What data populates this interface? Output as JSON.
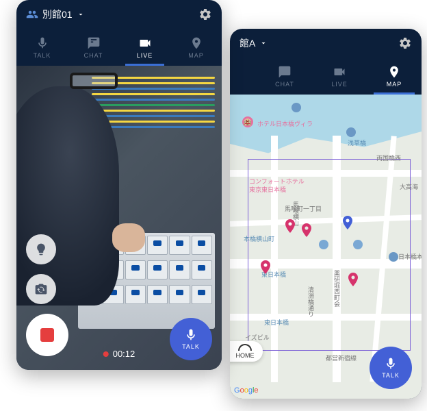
{
  "leftPhone": {
    "header": {
      "title": "別館01"
    },
    "tabs": [
      {
        "id": "talk",
        "label": "TALK"
      },
      {
        "id": "chat",
        "label": "CHAT"
      },
      {
        "id": "live",
        "label": "LIVE",
        "active": true
      },
      {
        "id": "map",
        "label": "MAP"
      }
    ],
    "recording": {
      "time": "00:12"
    },
    "talkButton": {
      "label": "TALK"
    }
  },
  "rightPhone": {
    "header": {
      "title": "館A"
    },
    "tabs": [
      {
        "id": "chat",
        "label": "CHAT"
      },
      {
        "id": "live",
        "label": "LIVE"
      },
      {
        "id": "map",
        "label": "MAP",
        "active": true
      }
    ],
    "talkButton": {
      "label": "TALK"
    },
    "homeButton": {
      "label": "HOME"
    },
    "mapAttribution": "Google",
    "mapLabels": {
      "hotel1": "ホテル日本橋ヴィラ",
      "comfort1": "コンフォートホテル",
      "comfort2": "東京東日本橋",
      "asakusa": "浅草橋",
      "ryogoku": "両国橋西",
      "odaka": "大高海",
      "bakuro1": "馬喰横山",
      "bakuro2": "馬喰町一丁目",
      "nihonbashi1": "本橋横山町",
      "nihonbashi_sta": "日本橋本",
      "higashi": "東日本橋",
      "higashi2": "東日本橋",
      "izumi": "イズビル",
      "kiyosu": "清洲橋通り",
      "yagen": "薬研堀西町会",
      "sensoku": "都営新宿線"
    }
  }
}
